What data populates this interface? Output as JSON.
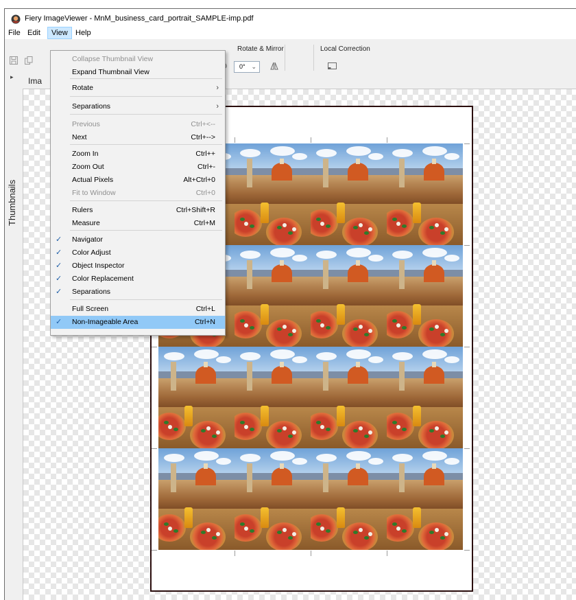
{
  "window": {
    "title": "Fiery ImageViewer - MnM_business_card_portrait_SAMPLE-imp.pdf"
  },
  "menubar": {
    "items": [
      "File",
      "Edit",
      "View",
      "Help"
    ],
    "active": "View"
  },
  "toolbar": {
    "rotate_mirror_label": "Rotate & Mirror",
    "rotate_value": "0°",
    "local_correction_label": "Local Correction"
  },
  "side_panel": {
    "thumbnails_label": "Thumbnails",
    "tab_label": "Ima"
  },
  "view_menu": {
    "items": [
      {
        "label": "Collapse Thumbnail View",
        "shortcut": "",
        "disabled": true,
        "checked": false,
        "submenu": false
      },
      {
        "label": "Expand Thumbnail View",
        "shortcut": "",
        "disabled": false,
        "checked": false,
        "submenu": false
      },
      {
        "label": "Rotate",
        "shortcut": "",
        "disabled": false,
        "checked": false,
        "submenu": true
      },
      {
        "label": "Separations",
        "shortcut": "",
        "disabled": false,
        "checked": false,
        "submenu": true
      },
      {
        "label": "Previous",
        "shortcut": "Ctrl+<--",
        "disabled": true,
        "checked": false,
        "submenu": false
      },
      {
        "label": "Next",
        "shortcut": "Ctrl+-->",
        "disabled": false,
        "checked": false,
        "submenu": false
      },
      {
        "label": "Zoom In",
        "shortcut": "Ctrl++",
        "disabled": false,
        "checked": false,
        "submenu": false
      },
      {
        "label": "Zoom Out",
        "shortcut": "Ctrl+-",
        "disabled": false,
        "checked": false,
        "submenu": false
      },
      {
        "label": "Actual Pixels",
        "shortcut": "Alt+Ctrl+0",
        "disabled": false,
        "checked": false,
        "submenu": false
      },
      {
        "label": "Fit to Window",
        "shortcut": "Ctrl+0",
        "disabled": true,
        "checked": false,
        "submenu": false
      },
      {
        "label": "Rulers",
        "shortcut": "Ctrl+Shift+R",
        "disabled": false,
        "checked": false,
        "submenu": false
      },
      {
        "label": "Measure",
        "shortcut": "Ctrl+M",
        "disabled": false,
        "checked": false,
        "submenu": false
      },
      {
        "label": "Navigator",
        "shortcut": "",
        "disabled": false,
        "checked": true,
        "submenu": false
      },
      {
        "label": "Color Adjust",
        "shortcut": "",
        "disabled": false,
        "checked": true,
        "submenu": false
      },
      {
        "label": "Object Inspector",
        "shortcut": "",
        "disabled": false,
        "checked": true,
        "submenu": false
      },
      {
        "label": "Color Replacement",
        "shortcut": "",
        "disabled": false,
        "checked": true,
        "submenu": false
      },
      {
        "label": "Separations",
        "shortcut": "",
        "disabled": false,
        "checked": true,
        "submenu": false
      },
      {
        "label": "Full Screen",
        "shortcut": "Ctrl+L",
        "disabled": false,
        "checked": false,
        "submenu": false
      },
      {
        "label": "Non-Imageable Area",
        "shortcut": "Ctrl+N",
        "disabled": false,
        "checked": true,
        "submenu": false,
        "highlighted": true
      }
    ]
  },
  "colors": {
    "menu_highlight": "#91c9f7",
    "active_menu": "#cce8ff",
    "check": "#1f5fa8",
    "sheet_border": "#2a0d0d"
  },
  "icons": [
    "app-logo-icon",
    "save-icon",
    "copy-icon",
    "rotate-icon",
    "mirror-icon",
    "local-correction-icon",
    "checkmark-icon",
    "submenu-arrow-icon",
    "expand-arrow-icon"
  ]
}
